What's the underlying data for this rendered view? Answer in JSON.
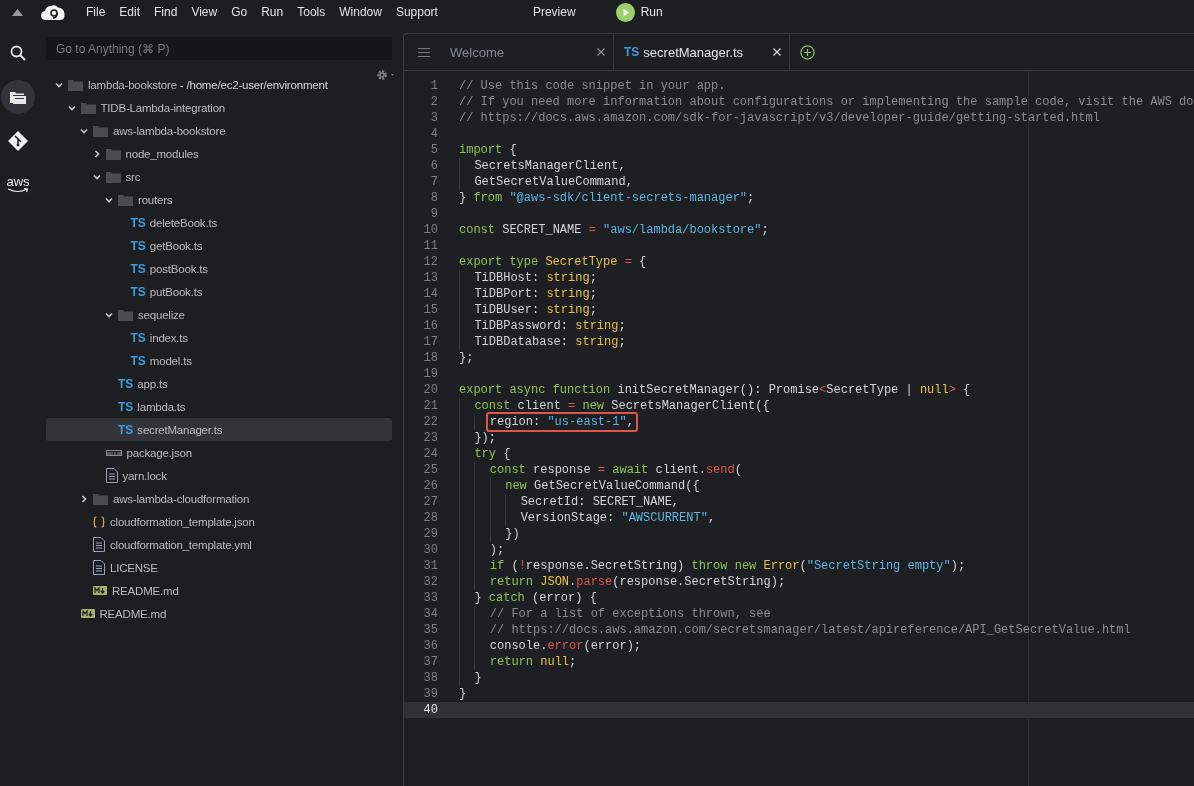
{
  "menu_bar": {
    "items": [
      "File",
      "Edit",
      "Find",
      "View",
      "Go",
      "Run",
      "Tools",
      "Window",
      "Support"
    ],
    "preview": "Preview",
    "run": "Run"
  },
  "activity_bar": [
    {
      "kind": "search",
      "selected": false
    },
    {
      "kind": "files",
      "selected": true
    },
    {
      "kind": "git",
      "selected": false
    },
    {
      "kind": "aws",
      "label": "aws",
      "selected": false
    }
  ],
  "go_to_anything": {
    "placeholder": "Go to Anything (⌘ P)"
  },
  "tree": [
    {
      "kind": "folder",
      "name": "lambda-bookstore",
      "path": " - /home/ec2-user/environment",
      "expanded": true,
      "selected": false,
      "children": [
        {
          "kind": "folder",
          "name": "TIDB-Lambda-integration",
          "expanded": true,
          "selected": false,
          "children": [
            {
              "kind": "folder",
              "name": "aws-lambda-bookstore",
              "expanded": true,
              "selected": false,
              "children": [
                {
                  "kind": "folder",
                  "name": "node_modules",
                  "expanded": false,
                  "selected": false
                },
                {
                  "kind": "folder",
                  "name": "src",
                  "expanded": true,
                  "selected": false,
                  "children": [
                    {
                      "kind": "folder",
                      "name": "routers",
                      "expanded": true,
                      "selected": false,
                      "children": [
                        {
                          "kind": "ts",
                          "badge": "TS",
                          "name": "deleteBook.ts",
                          "selected": false
                        },
                        {
                          "kind": "ts",
                          "badge": "TS",
                          "name": "getBook.ts",
                          "selected": false
                        },
                        {
                          "kind": "ts",
                          "badge": "TS",
                          "name": "postBook.ts",
                          "selected": false
                        },
                        {
                          "kind": "ts",
                          "badge": "TS",
                          "name": "putBook.ts",
                          "selected": false
                        }
                      ]
                    },
                    {
                      "kind": "folder",
                      "name": "sequelize",
                      "expanded": true,
                      "selected": false,
                      "children": [
                        {
                          "kind": "ts",
                          "badge": "TS",
                          "name": "index.ts",
                          "selected": false
                        },
                        {
                          "kind": "ts",
                          "badge": "TS",
                          "name": "model.ts",
                          "selected": false
                        }
                      ]
                    },
                    {
                      "kind": "ts",
                      "badge": "TS",
                      "name": "app.ts",
                      "selected": false
                    },
                    {
                      "kind": "ts",
                      "badge": "TS",
                      "name": "lambda.ts",
                      "selected": false
                    },
                    {
                      "kind": "ts",
                      "badge": "TS",
                      "name": "secretManager.ts",
                      "selected": true
                    }
                  ]
                },
                {
                  "kind": "npm",
                  "name": "package.json",
                  "selected": false
                },
                {
                  "kind": "text",
                  "name": "yarn.lock",
                  "selected": false
                }
              ]
            },
            {
              "kind": "folder",
              "name": "aws-lambda-cloudformation",
              "expanded": false,
              "selected": false
            },
            {
              "kind": "json",
              "name": "cloudformation_template.json",
              "selected": false
            },
            {
              "kind": "text",
              "name": "cloudformation_template.yml",
              "selected": false
            },
            {
              "kind": "text",
              "name": "LICENSE",
              "selected": false
            },
            {
              "kind": "md",
              "name": "README.md",
              "selected": false
            }
          ]
        },
        {
          "kind": "md",
          "name": "README.md",
          "selected": false
        }
      ]
    }
  ],
  "tabs": [
    {
      "label": "Welcome",
      "selected": false
    },
    {
      "badge": "TS",
      "label": "secretManager.ts",
      "selected": true
    }
  ],
  "editor": {
    "lines": [
      {
        "n": "1",
        "active": false,
        "boxed": false,
        "t": [
          {
            "kind": "comment",
            "text": "// Use this code snippet in your app."
          }
        ]
      },
      {
        "n": "2",
        "active": false,
        "boxed": false,
        "t": [
          {
            "kind": "comment",
            "text": "// If you need more information about configurations or implementing the sample code, visit the AWS do"
          }
        ]
      },
      {
        "n": "3",
        "active": false,
        "boxed": false,
        "t": [
          {
            "kind": "comment",
            "text": "// https://docs.aws.amazon.com/sdk-for-javascript/v3/developer-guide/getting-started.html"
          }
        ]
      },
      {
        "n": "4",
        "active": false
      },
      {
        "n": "5",
        "active": false,
        "boxed": false,
        "t": [
          {
            "kind": "keyword",
            "text": "import"
          },
          {
            "kind": "plain",
            "text": " {"
          }
        ]
      },
      {
        "n": "6",
        "active": false,
        "boxed": false,
        "t": [
          {
            "kind": "plain",
            "text": "  SecretsManagerClient,"
          }
        ]
      },
      {
        "n": "7",
        "active": false,
        "boxed": false,
        "t": [
          {
            "kind": "plain",
            "text": "  GetSecretValueCommand,"
          }
        ]
      },
      {
        "n": "8",
        "active": false,
        "boxed": false,
        "t": [
          {
            "kind": "plain",
            "text": "} "
          },
          {
            "kind": "keyword",
            "text": "from"
          },
          {
            "kind": "string",
            "text": " \"@aws-sdk/client-secrets-manager\""
          },
          {
            "kind": "plain",
            "text": ";"
          }
        ]
      },
      {
        "n": "9",
        "active": false
      },
      {
        "n": "10",
        "active": false,
        "boxed": false,
        "t": [
          {
            "kind": "keyword",
            "text": "const"
          },
          {
            "kind": "plain",
            "text": " SECRET_NAME "
          },
          {
            "kind": "op",
            "text": "="
          },
          {
            "kind": "string",
            "text": " \"aws/lambda/bookstore\""
          },
          {
            "kind": "plain",
            "text": ";"
          }
        ]
      },
      {
        "n": "11",
        "active": false
      },
      {
        "n": "12",
        "active": false,
        "boxed": false,
        "t": [
          {
            "kind": "keyword",
            "text": "export type"
          },
          {
            "kind": "type",
            "text": " SecretType"
          },
          {
            "kind": "op",
            "text": " ="
          },
          {
            "kind": "plain",
            "text": " {"
          }
        ]
      },
      {
        "n": "13",
        "active": false,
        "boxed": false,
        "t": [
          {
            "kind": "plain",
            "text": "  TiDBHost: "
          },
          {
            "kind": "type",
            "text": "string"
          },
          {
            "kind": "plain",
            "text": ";"
          }
        ]
      },
      {
        "n": "14",
        "active": false,
        "boxed": false,
        "t": [
          {
            "kind": "plain",
            "text": "  TiDBPort: "
          },
          {
            "kind": "type",
            "text": "string"
          },
          {
            "kind": "plain",
            "text": ";"
          }
        ]
      },
      {
        "n": "15",
        "active": false,
        "boxed": false,
        "t": [
          {
            "kind": "plain",
            "text": "  TiDBUser: "
          },
          {
            "kind": "type",
            "text": "string"
          },
          {
            "kind": "plain",
            "text": ";"
          }
        ]
      },
      {
        "n": "16",
        "active": false,
        "boxed": false,
        "t": [
          {
            "kind": "plain",
            "text": "  TiDBPassword: "
          },
          {
            "kind": "type",
            "text": "string"
          },
          {
            "kind": "plain",
            "text": ";"
          }
        ]
      },
      {
        "n": "17",
        "active": false,
        "boxed": false,
        "t": [
          {
            "kind": "plain",
            "text": "  TiDBDatabase: "
          },
          {
            "kind": "type",
            "text": "string"
          },
          {
            "kind": "plain",
            "text": ";"
          }
        ]
      },
      {
        "n": "18",
        "active": false,
        "boxed": false,
        "t": [
          {
            "kind": "plain",
            "text": "};"
          }
        ]
      },
      {
        "n": "19",
        "active": false
      },
      {
        "n": "20",
        "active": false,
        "boxed": false,
        "t": [
          {
            "kind": "keyword",
            "text": "export async function"
          },
          {
            "kind": "plain",
            "text": " initSecretManager(): Promise"
          },
          {
            "kind": "op",
            "text": "<"
          },
          {
            "kind": "plain",
            "text": "SecretType | "
          },
          {
            "kind": "type",
            "text": "null"
          },
          {
            "kind": "op",
            "text": ">"
          },
          {
            "kind": "plain",
            "text": " {"
          }
        ]
      },
      {
        "n": "21",
        "active": false,
        "boxed": false,
        "t": [
          {
            "kind": "keyword",
            "text": "  const"
          },
          {
            "kind": "plain",
            "text": " client "
          },
          {
            "kind": "op",
            "text": "="
          },
          {
            "kind": "keyword",
            "text": " new"
          },
          {
            "kind": "plain",
            "text": " SecretsManagerClient({"
          }
        ]
      },
      {
        "n": "22",
        "active": false,
        "boxed": true,
        "t": [
          {
            "kind": "plain",
            "text": "    region: "
          },
          {
            "kind": "string",
            "text": "\"us-east-1\""
          },
          {
            "kind": "plain",
            "text": ","
          }
        ]
      },
      {
        "n": "23",
        "active": false,
        "boxed": false,
        "t": [
          {
            "kind": "plain",
            "text": "  });"
          }
        ]
      },
      {
        "n": "24",
        "active": false,
        "boxed": false,
        "t": [
          {
            "kind": "keyword",
            "text": "  try"
          },
          {
            "kind": "plain",
            "text": " {"
          }
        ]
      },
      {
        "n": "25",
        "active": false,
        "boxed": false,
        "t": [
          {
            "kind": "keyword",
            "text": "    const"
          },
          {
            "kind": "plain",
            "text": " response "
          },
          {
            "kind": "op",
            "text": "="
          },
          {
            "kind": "keyword",
            "text": " await"
          },
          {
            "kind": "plain",
            "text": " client."
          },
          {
            "kind": "op",
            "text": "send"
          },
          {
            "kind": "plain",
            "text": "("
          }
        ]
      },
      {
        "n": "26",
        "active": false,
        "boxed": false,
        "t": [
          {
            "kind": "keyword",
            "text": "      new"
          },
          {
            "kind": "plain",
            "text": " GetSecretValueCommand({"
          }
        ]
      },
      {
        "n": "27",
        "active": false,
        "boxed": false,
        "t": [
          {
            "kind": "plain",
            "text": "        SecretId: SECRET_NAME,"
          }
        ]
      },
      {
        "n": "28",
        "active": false,
        "boxed": false,
        "t": [
          {
            "kind": "plain",
            "text": "        VersionStage: "
          },
          {
            "kind": "string",
            "text": "\"AWSCURRENT\""
          },
          {
            "kind": "plain",
            "text": ","
          }
        ]
      },
      {
        "n": "29",
        "active": false,
        "boxed": false,
        "t": [
          {
            "kind": "plain",
            "text": "      })"
          }
        ]
      },
      {
        "n": "30",
        "active": false,
        "boxed": false,
        "t": [
          {
            "kind": "plain",
            "text": "    );"
          }
        ]
      },
      {
        "n": "31",
        "active": false,
        "boxed": false,
        "t": [
          {
            "kind": "keyword",
            "text": "    if"
          },
          {
            "kind": "plain",
            "text": " ("
          },
          {
            "kind": "op",
            "text": "!"
          },
          {
            "kind": "plain",
            "text": "response.SecretString) "
          },
          {
            "kind": "keyword",
            "text": "throw new"
          },
          {
            "kind": "type",
            "text": " Error"
          },
          {
            "kind": "plain",
            "text": "("
          },
          {
            "kind": "string",
            "text": "\"SecretString empty\""
          },
          {
            "kind": "plain",
            "text": ");"
          }
        ]
      },
      {
        "n": "32",
        "active": false,
        "boxed": false,
        "t": [
          {
            "kind": "keyword",
            "text": "    return"
          },
          {
            "kind": "type",
            "text": " JSON"
          },
          {
            "kind": "plain",
            "text": "."
          },
          {
            "kind": "op",
            "text": "parse"
          },
          {
            "kind": "plain",
            "text": "(response.SecretString);"
          }
        ]
      },
      {
        "n": "33",
        "active": false,
        "boxed": false,
        "t": [
          {
            "kind": "plain",
            "text": "  } "
          },
          {
            "kind": "keyword",
            "text": "catch"
          },
          {
            "kind": "plain",
            "text": " (error) {"
          }
        ]
      },
      {
        "n": "34",
        "active": false,
        "boxed": false,
        "t": [
          {
            "kind": "comment",
            "text": "    // For a list of exceptions thrown, see"
          }
        ]
      },
      {
        "n": "35",
        "active": false,
        "boxed": false,
        "t": [
          {
            "kind": "comment",
            "text": "    // https://docs.aws.amazon.com/secretsmanager/latest/apireference/API_GetSecretValue.html"
          }
        ]
      },
      {
        "n": "36",
        "active": false,
        "boxed": false,
        "t": [
          {
            "kind": "plain",
            "text": "    console."
          },
          {
            "kind": "op",
            "text": "error"
          },
          {
            "kind": "plain",
            "text": "(error);"
          }
        ]
      },
      {
        "n": "37",
        "active": false,
        "boxed": false,
        "t": [
          {
            "kind": "keyword",
            "text": "    return"
          },
          {
            "kind": "type",
            "text": " null"
          },
          {
            "kind": "plain",
            "text": ";"
          }
        ]
      },
      {
        "n": "38",
        "active": false,
        "boxed": false,
        "t": [
          {
            "kind": "plain",
            "text": "  }"
          }
        ]
      },
      {
        "n": "39",
        "active": false,
        "boxed": false,
        "t": [
          {
            "kind": "plain",
            "text": "}"
          }
        ]
      },
      {
        "n": "40",
        "active": true
      }
    ]
  }
}
